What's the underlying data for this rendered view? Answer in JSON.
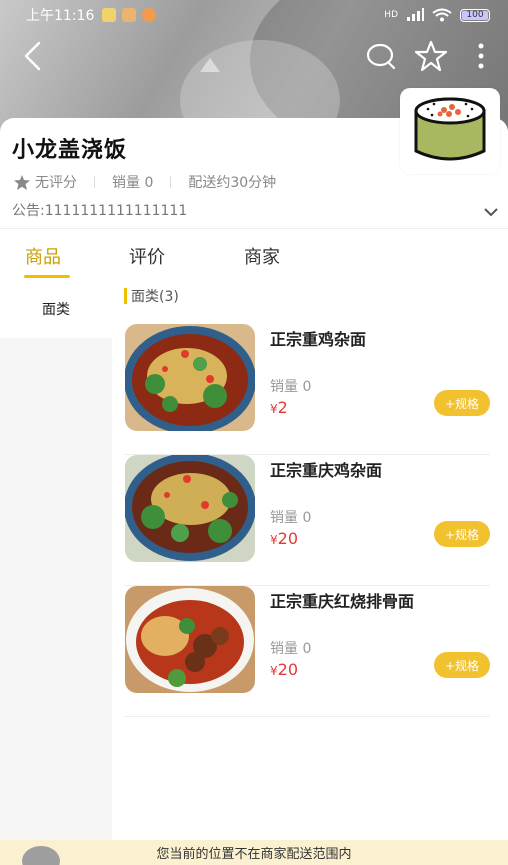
{
  "status_bar": {
    "time": "上午11:16",
    "signal": "HD",
    "battery": "100"
  },
  "nav": {
    "back_icon": "back-arrow-icon",
    "chat_icon": "chat-bubble-icon",
    "star_icon": "star-icon",
    "more_icon": "more-vertical-icon"
  },
  "shop": {
    "name": "小龙盖浇饭",
    "rating": "无评分",
    "sales": "销量 0",
    "delivery": "配送约30分钟",
    "notice": "公告:1111111111111111"
  },
  "tabs": [
    {
      "label": "商品"
    },
    {
      "label": "评价"
    },
    {
      "label": "商家"
    }
  ],
  "categories": [
    {
      "label": "面类"
    }
  ],
  "section": {
    "title": "面类(3)"
  },
  "items": [
    {
      "name": "正宗重鸡杂面",
      "sales": "销量 0",
      "currency": "¥",
      "price": "2",
      "spec_label": "+规格"
    },
    {
      "name": "正宗重庆鸡杂面",
      "sales": "销量 0",
      "currency": "¥",
      "price": "20",
      "spec_label": "+规格"
    },
    {
      "name": "正宗重庆红烧排骨面",
      "sales": "销量 0",
      "currency": "¥",
      "price": "20",
      "spec_label": "+规格"
    }
  ],
  "footer": {
    "message": "您当前的位置不在商家配送范围内"
  },
  "colors": {
    "accent": "#f0c000",
    "price": "#e53935",
    "spec_button": "#f2c12e",
    "footer_bg": "#fbf0cf"
  }
}
